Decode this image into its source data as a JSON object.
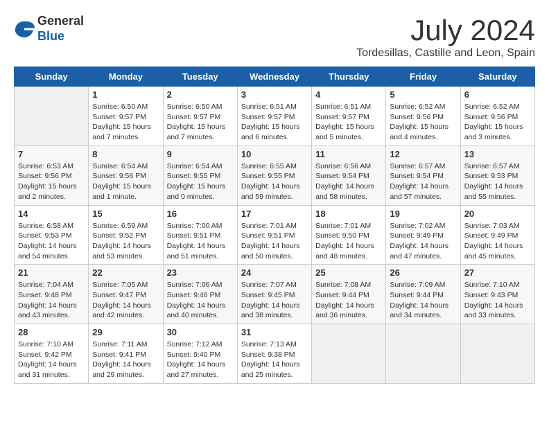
{
  "header": {
    "logo_line1": "General",
    "logo_line2": "Blue",
    "month_title": "July 2024",
    "location": "Tordesillas, Castille and Leon, Spain"
  },
  "weekdays": [
    "Sunday",
    "Monday",
    "Tuesday",
    "Wednesday",
    "Thursday",
    "Friday",
    "Saturday"
  ],
  "weeks": [
    [
      {
        "day": "",
        "info": ""
      },
      {
        "day": "1",
        "info": "Sunrise: 6:50 AM\nSunset: 9:57 PM\nDaylight: 15 hours\nand 7 minutes."
      },
      {
        "day": "2",
        "info": "Sunrise: 6:50 AM\nSunset: 9:57 PM\nDaylight: 15 hours\nand 7 minutes."
      },
      {
        "day": "3",
        "info": "Sunrise: 6:51 AM\nSunset: 9:57 PM\nDaylight: 15 hours\nand 6 minutes."
      },
      {
        "day": "4",
        "info": "Sunrise: 6:51 AM\nSunset: 9:57 PM\nDaylight: 15 hours\nand 5 minutes."
      },
      {
        "day": "5",
        "info": "Sunrise: 6:52 AM\nSunset: 9:56 PM\nDaylight: 15 hours\nand 4 minutes."
      },
      {
        "day": "6",
        "info": "Sunrise: 6:52 AM\nSunset: 9:56 PM\nDaylight: 15 hours\nand 3 minutes."
      }
    ],
    [
      {
        "day": "7",
        "info": "Sunrise: 6:53 AM\nSunset: 9:56 PM\nDaylight: 15 hours\nand 2 minutes."
      },
      {
        "day": "8",
        "info": "Sunrise: 6:54 AM\nSunset: 9:56 PM\nDaylight: 15 hours\nand 1 minute."
      },
      {
        "day": "9",
        "info": "Sunrise: 6:54 AM\nSunset: 9:55 PM\nDaylight: 15 hours\nand 0 minutes."
      },
      {
        "day": "10",
        "info": "Sunrise: 6:55 AM\nSunset: 9:55 PM\nDaylight: 14 hours\nand 59 minutes."
      },
      {
        "day": "11",
        "info": "Sunrise: 6:56 AM\nSunset: 9:54 PM\nDaylight: 14 hours\nand 58 minutes."
      },
      {
        "day": "12",
        "info": "Sunrise: 6:57 AM\nSunset: 9:54 PM\nDaylight: 14 hours\nand 57 minutes."
      },
      {
        "day": "13",
        "info": "Sunrise: 6:57 AM\nSunset: 9:53 PM\nDaylight: 14 hours\nand 55 minutes."
      }
    ],
    [
      {
        "day": "14",
        "info": "Sunrise: 6:58 AM\nSunset: 9:53 PM\nDaylight: 14 hours\nand 54 minutes."
      },
      {
        "day": "15",
        "info": "Sunrise: 6:59 AM\nSunset: 9:52 PM\nDaylight: 14 hours\nand 53 minutes."
      },
      {
        "day": "16",
        "info": "Sunrise: 7:00 AM\nSunset: 9:51 PM\nDaylight: 14 hours\nand 51 minutes."
      },
      {
        "day": "17",
        "info": "Sunrise: 7:01 AM\nSunset: 9:51 PM\nDaylight: 14 hours\nand 50 minutes."
      },
      {
        "day": "18",
        "info": "Sunrise: 7:01 AM\nSunset: 9:50 PM\nDaylight: 14 hours\nand 48 minutes."
      },
      {
        "day": "19",
        "info": "Sunrise: 7:02 AM\nSunset: 9:49 PM\nDaylight: 14 hours\nand 47 minutes."
      },
      {
        "day": "20",
        "info": "Sunrise: 7:03 AM\nSunset: 9:49 PM\nDaylight: 14 hours\nand 45 minutes."
      }
    ],
    [
      {
        "day": "21",
        "info": "Sunrise: 7:04 AM\nSunset: 9:48 PM\nDaylight: 14 hours\nand 43 minutes."
      },
      {
        "day": "22",
        "info": "Sunrise: 7:05 AM\nSunset: 9:47 PM\nDaylight: 14 hours\nand 42 minutes."
      },
      {
        "day": "23",
        "info": "Sunrise: 7:06 AM\nSunset: 9:46 PM\nDaylight: 14 hours\nand 40 minutes."
      },
      {
        "day": "24",
        "info": "Sunrise: 7:07 AM\nSunset: 9:45 PM\nDaylight: 14 hours\nand 38 minutes."
      },
      {
        "day": "25",
        "info": "Sunrise: 7:08 AM\nSunset: 9:44 PM\nDaylight: 14 hours\nand 36 minutes."
      },
      {
        "day": "26",
        "info": "Sunrise: 7:09 AM\nSunset: 9:44 PM\nDaylight: 14 hours\nand 34 minutes."
      },
      {
        "day": "27",
        "info": "Sunrise: 7:10 AM\nSunset: 9:43 PM\nDaylight: 14 hours\nand 33 minutes."
      }
    ],
    [
      {
        "day": "28",
        "info": "Sunrise: 7:10 AM\nSunset: 9:42 PM\nDaylight: 14 hours\nand 31 minutes."
      },
      {
        "day": "29",
        "info": "Sunrise: 7:11 AM\nSunset: 9:41 PM\nDaylight: 14 hours\nand 29 minutes."
      },
      {
        "day": "30",
        "info": "Sunrise: 7:12 AM\nSunset: 9:40 PM\nDaylight: 14 hours\nand 27 minutes."
      },
      {
        "day": "31",
        "info": "Sunrise: 7:13 AM\nSunset: 9:38 PM\nDaylight: 14 hours\nand 25 minutes."
      },
      {
        "day": "",
        "info": ""
      },
      {
        "day": "",
        "info": ""
      },
      {
        "day": "",
        "info": ""
      }
    ]
  ]
}
